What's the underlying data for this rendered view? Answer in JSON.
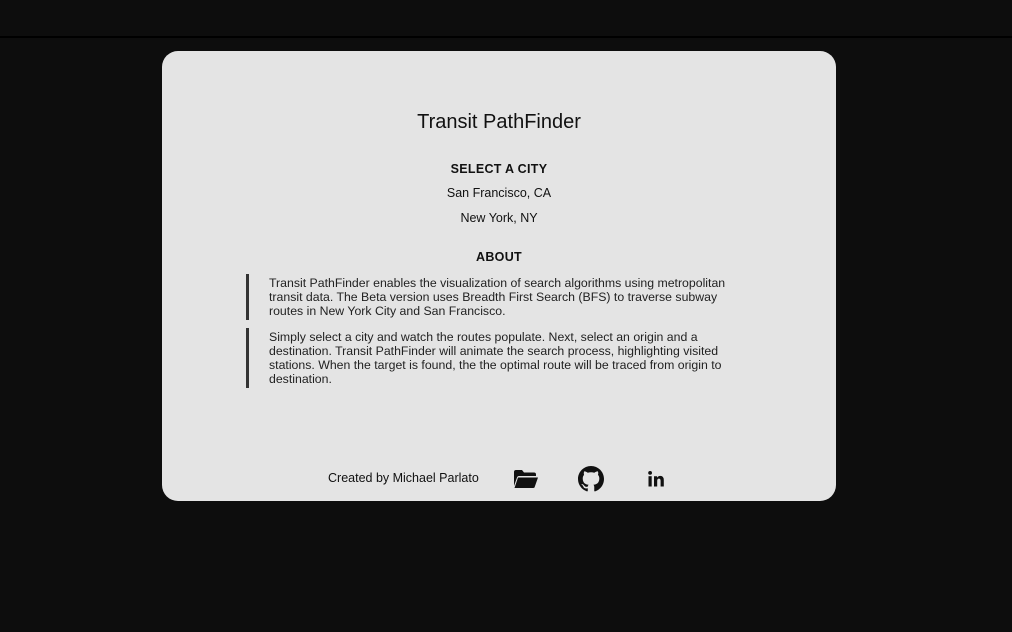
{
  "app": {
    "title": "Transit PathFinder"
  },
  "city_select": {
    "heading": "SELECT A CITY",
    "options": [
      "San Francisco, CA",
      "New York, NY"
    ]
  },
  "about": {
    "heading": "ABOUT",
    "paragraphs": [
      "Transit PathFinder enables the visualization of search algorithms using metropolitan transit data. The Beta version uses Breadth First Search (BFS) to traverse subway routes in New York City and San Francisco.",
      "Simply select a city and watch the routes populate. Next, select an origin and a destination. Transit PathFinder will animate the search process, highlighting visited stations. When the target is found, the the optimal route will be traced from origin to destination."
    ]
  },
  "footer": {
    "credit": "Created by Michael Parlato",
    "icons": [
      "folder-icon",
      "github-icon",
      "linkedin-icon"
    ]
  },
  "colors": {
    "background": "#0d0d0d",
    "card": "#e4e4e4",
    "text": "#111111",
    "accent_bar": "#333333"
  }
}
